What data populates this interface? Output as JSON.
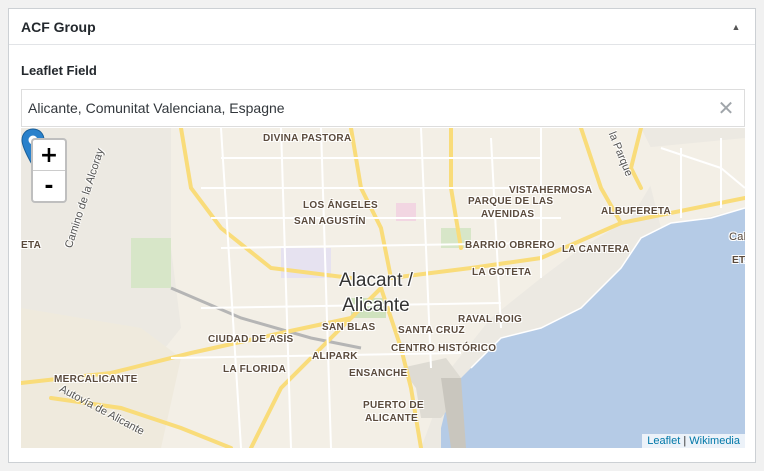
{
  "metabox": {
    "title": "ACF Group",
    "toggle_icon": "triangle-up-icon"
  },
  "field": {
    "label": "Leaflet Field",
    "search_value": "Alicante, Comunitat Valenciana, Espagne",
    "clear_glyph": "✕"
  },
  "map": {
    "zoom_in": "+",
    "zoom_out": "-",
    "city": {
      "line1": "Alacant /",
      "line2": "Alicante"
    },
    "districts": [
      "DIVINA PASTORA",
      "LOS ÁNGELES",
      "SAN AGUSTÍN",
      "VISTAHERMOSA",
      "PARQUE DE LAS",
      "AVENIDAS",
      "ALBUFERETA",
      "BARRIO OBRERO",
      "LA CANTERA",
      "LA GOTETA",
      "RAVAL ROIG",
      "SAN BLAS",
      "SANTA CRUZ",
      "CIUDAD DE ASÍS",
      "CENTRO HISTÓRICO",
      "ALIPARK",
      "LA FLORIDA",
      "ENSANCHE",
      "MERCALICANTE",
      "PUERTO DE",
      "ALICANTE"
    ],
    "roads": {
      "alcoray": "Camino de la Alcoray",
      "autovia": "Autovía de Alicante",
      "parque": "la Parque"
    },
    "edge_fragments": [
      "ETA",
      "Cal",
      "ETA"
    ],
    "attribution": {
      "leaflet": "Leaflet",
      "separator": " | ",
      "wikimedia": "Wikimedia"
    },
    "colors": {
      "land": "#ece9e2",
      "sea": "#b5cbe6",
      "urban": "#f6f3ec",
      "road_major": "#f9dc7a",
      "marker": "#2a81cb"
    }
  }
}
